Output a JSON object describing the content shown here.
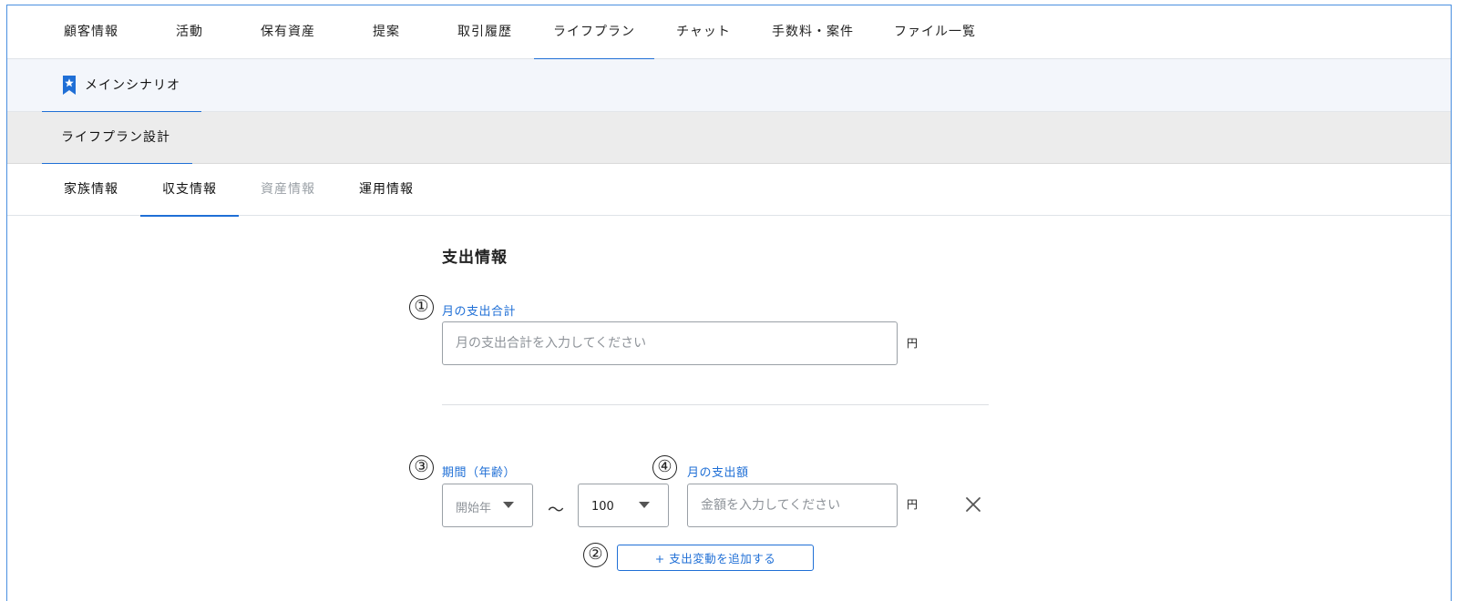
{
  "top_nav": {
    "tabs": [
      {
        "label": "顧客情報"
      },
      {
        "label": "活動"
      },
      {
        "label": "保有資産"
      },
      {
        "label": "提案"
      },
      {
        "label": "取引履歴"
      },
      {
        "label": "ライフプラン"
      },
      {
        "label": "チャット"
      },
      {
        "label": "手数料・案件"
      },
      {
        "label": "ファイル一覧"
      }
    ],
    "active": "ライフプラン"
  },
  "scenario": {
    "label": "メインシナリオ",
    "icon": "bookmark-star-icon"
  },
  "design": {
    "label": "ライフプラン設計"
  },
  "sub_tabs": {
    "tabs": [
      {
        "label": "家族情報",
        "state": "normal"
      },
      {
        "label": "収支情報",
        "state": "active"
      },
      {
        "label": "資産情報",
        "state": "disabled"
      },
      {
        "label": "運用情報",
        "state": "normal"
      }
    ]
  },
  "form": {
    "section_title": "支出情報",
    "monthly_total": {
      "marker": "①",
      "label": "月の支出合計",
      "placeholder": "月の支出合計を入力してください",
      "value": "",
      "unit": "円"
    },
    "change_row": {
      "period_marker": "③",
      "period_label": "期間（年齢）",
      "start_select": {
        "value": "開始年",
        "is_placeholder": true
      },
      "separator": "～",
      "end_select": {
        "value": "100",
        "is_placeholder": false
      },
      "amount_marker": "④",
      "amount_label": "月の支出額",
      "amount_placeholder": "金額を入力してください",
      "amount_unit": "円",
      "remove_icon": "close-icon"
    },
    "add_change": {
      "marker": "②",
      "label": "+ 支出変動を追加する"
    }
  },
  "colors": {
    "accent": "#1f6fd6",
    "border": "#9aa0a6",
    "scenario_bg": "#f3f6fb",
    "design_bg": "#ececec"
  }
}
